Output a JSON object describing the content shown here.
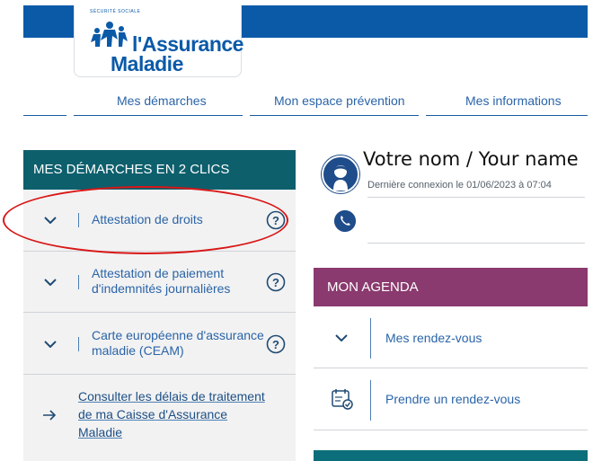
{
  "brand": {
    "tagline": "SÉCURITÉ SOCIALE",
    "name_line1": "l'Assurance",
    "name_line2": "Maladie",
    "color": "#0b5aa8"
  },
  "nav": {
    "items": [
      {
        "label": "Mes démarches"
      },
      {
        "label": "Mon espace prévention"
      },
      {
        "label": "Mes informations"
      }
    ]
  },
  "demarches": {
    "title": "MES DÉMARCHES EN 2 CLICS",
    "header_color": "#0d5f6c",
    "items": [
      {
        "label": "Attestation de droits",
        "icon": "chevron-down-icon",
        "help_icon": "question-icon"
      },
      {
        "label": "Attestation de paiement d'indemnités journalières",
        "line1": "Attestation de paiement",
        "line2": "d'indemnités journalières",
        "icon": "chevron-down-icon",
        "help_icon": "question-icon"
      },
      {
        "label": "Carte européenne d'assurance maladie (CEAM)",
        "line1": "Carte européenne d'assurance",
        "line2": "maladie (CEAM)",
        "icon": "chevron-down-icon",
        "help_icon": "question-icon"
      },
      {
        "label": "Consulter les délais de traitement de ma Caisse d'Assurance Maladie",
        "line1": "Consulter les délais de traitement",
        "line2": "de ma Caisse d'Assurance",
        "line3": "Maladie",
        "icon": "arrow-right-icon"
      }
    ]
  },
  "profile": {
    "name": "Votre nom / Your name",
    "last_login": "Dernière connexion le 01/06/2023 à 07:04",
    "avatar_icon": "user-avatar-icon",
    "phone_icon": "phone-icon"
  },
  "agenda": {
    "title": "MON AGENDA",
    "header_color": "#8a3a6e",
    "items": [
      {
        "label": "Mes rendez-vous",
        "icon": "chevron-down-icon"
      },
      {
        "label": "Prendre un rendez-vous",
        "icon": "calendar-check-icon"
      }
    ]
  },
  "annotation": {
    "color": "#d91616"
  }
}
